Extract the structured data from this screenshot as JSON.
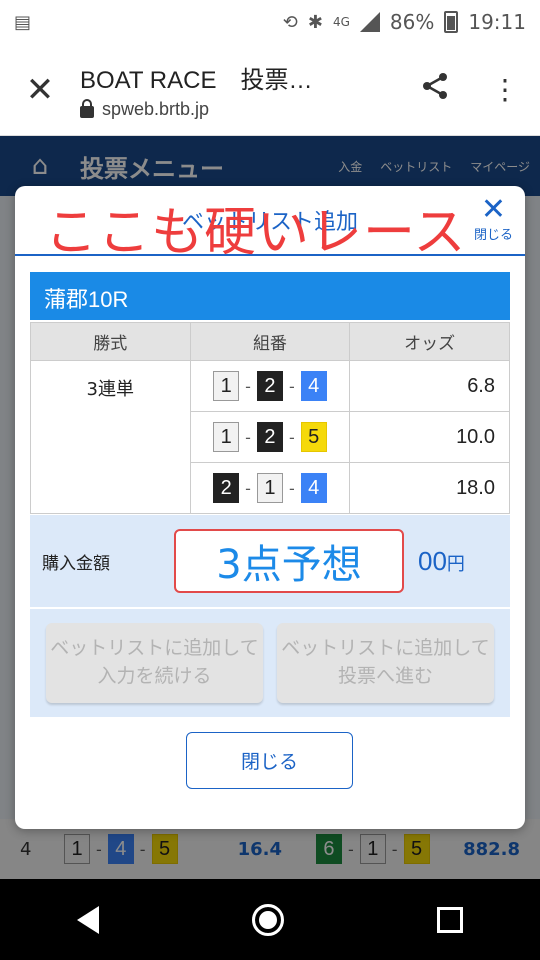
{
  "status_bar": {
    "battery": "86%",
    "time": "19:11",
    "network": "4G"
  },
  "browser": {
    "title": "BOAT RACE　投票…",
    "url": "spweb.brtb.jp"
  },
  "background_page": {
    "menu_title": "投票メニュー",
    "home_label": "トップ",
    "nav_items": [
      "入金",
      "ベットリスト",
      "マイページ"
    ],
    "bottom_row": {
      "rank": "4",
      "left_combo": [
        "1",
        "4",
        "5"
      ],
      "left_odds": "16.4",
      "right_combo": [
        "6",
        "1",
        "5"
      ],
      "right_odds": "882.8"
    }
  },
  "modal": {
    "title": "ベットリスト追加",
    "overlay_text": "ここも硬いレース",
    "close_label": "閉じる",
    "race": "蒲郡10R",
    "table": {
      "headers": [
        "勝式",
        "組番",
        "オッズ"
      ],
      "bet_type": "3連単",
      "rows": [
        {
          "combo": [
            "1",
            "2",
            "4"
          ],
          "odds": "6.8"
        },
        {
          "combo": [
            "1",
            "2",
            "5"
          ],
          "odds": "10.0"
        },
        {
          "combo": [
            "2",
            "1",
            "4"
          ],
          "odds": "18.0"
        }
      ]
    },
    "purchase_label": "購入金額",
    "amount_overlay": "3点予想",
    "amount_suffix": "00",
    "yen": "円",
    "button_continue": "ベットリストに追加して\n入力を続ける",
    "button_vote": "ベットリストに追加して\n投票へ進む",
    "close_button": "閉じる"
  },
  "colors": {
    "accent_blue": "#1b63c6",
    "race_bar": "#1a8ae6",
    "overlay_red": "#ee3d3d",
    "boat_1": "#f2f2f2",
    "boat_2": "#222222",
    "boat_4": "#3b82f6",
    "boat_5": "#f5d90a",
    "boat_6": "#1d8a3f"
  }
}
